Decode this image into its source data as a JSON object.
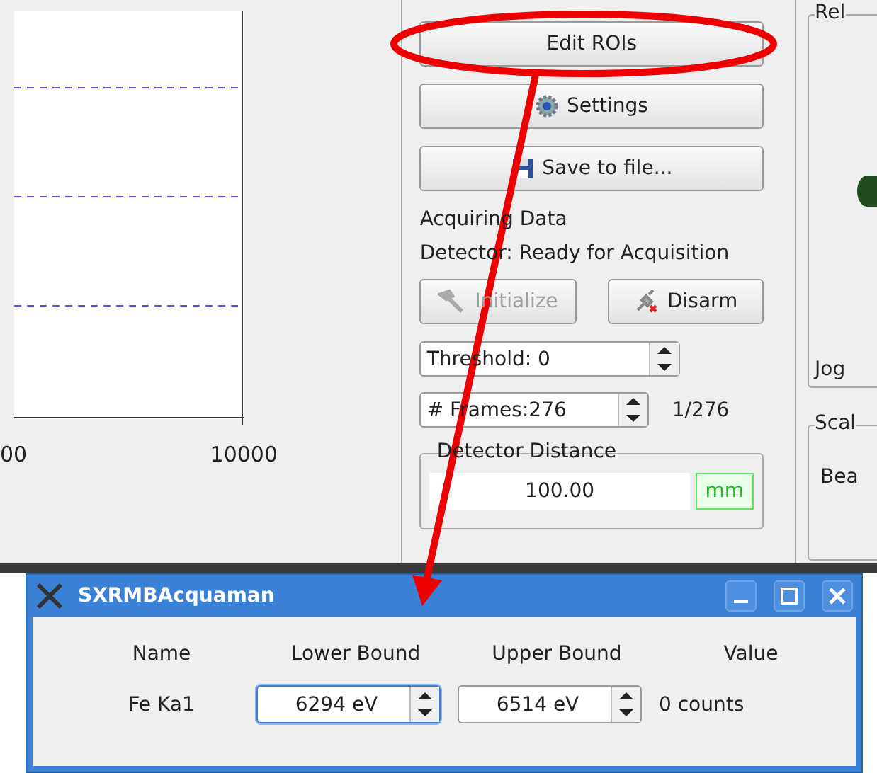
{
  "plot": {
    "x_tick_labels": [
      "00",
      "10000"
    ]
  },
  "buttons": [
    {
      "label": "Edit ROIs",
      "kind": "plain"
    },
    {
      "label": "Settings",
      "kind": "gear"
    },
    {
      "label": "Save to file...",
      "kind": "disk"
    }
  ],
  "status_lines": [
    "Acquiring Data",
    "Detector: Ready for Acquisition"
  ],
  "action_buttons": [
    {
      "label": "Initialize",
      "kind": "tools",
      "disabled": true
    },
    {
      "label": "Disarm",
      "kind": "plug",
      "disabled": false
    }
  ],
  "threshold": {
    "value": "Threshold: 0"
  },
  "frames": {
    "value": "# Frames:276",
    "progress": "1/276"
  },
  "detector_distance": {
    "title": "Detector Distance",
    "value": "100.00",
    "unit": "mm"
  },
  "right_panel": {
    "group_1_label": "Rel",
    "jog_label": "Jog",
    "group_2_title": "Scal",
    "group_2_label": "Bea"
  },
  "dialog": {
    "title": "SXRMBAcquaman",
    "columns": [
      "Name",
      "Lower Bound",
      "Upper Bound",
      "Value"
    ],
    "rows": [
      {
        "name": "Fe Ka1",
        "lower": {
          "value": "6294 eV",
          "focused": true
        },
        "upper": {
          "value": "6514 eV",
          "focused": false
        },
        "value": "0 counts"
      }
    ]
  }
}
